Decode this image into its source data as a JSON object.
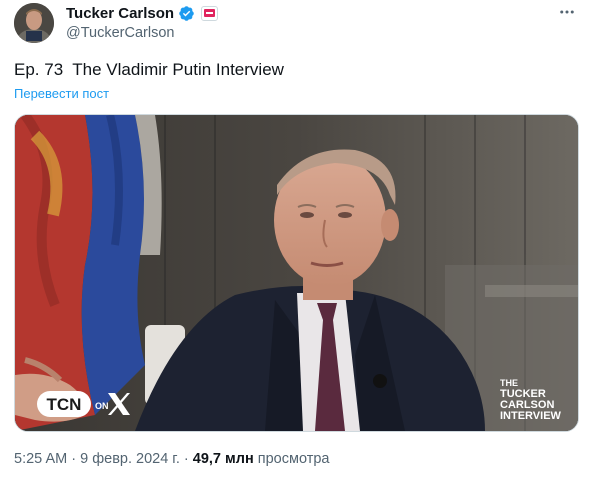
{
  "author": {
    "display_name": "Tucker Carlson",
    "handle": "@TuckerCarlson"
  },
  "tweet": {
    "text": "Ep. 73  The Vladimir Putin Interview",
    "translate_label": "Перевести пост"
  },
  "media": {
    "tcn_badge": "TCN",
    "tcn_suffix": "ON",
    "watermark_line1": "THE",
    "watermark_line2": "TUCKER",
    "watermark_line3": "CARLSON",
    "watermark_line4": "INTERVIEW"
  },
  "meta": {
    "time": "5:25 AM",
    "separator": "·",
    "date": "9 февр. 2024 г.",
    "views_count": "49,7 млн",
    "views_label": "просмотра"
  },
  "colors": {
    "accent": "#1d9bf0",
    "secondary_text": "#536471",
    "verified": "#1d9bf0"
  },
  "icons": [
    "avatar",
    "verified-badge-icon",
    "affiliate-badge-icon",
    "more-options-icon",
    "x-logo-icon"
  ]
}
